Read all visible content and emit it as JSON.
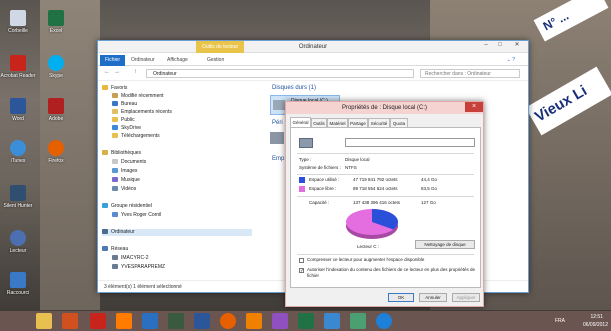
{
  "desktop": {
    "icons": [
      "Corbeille",
      "Acrobat Reader",
      "Word",
      "Excel",
      "iTunes",
      "Skype",
      "Adobe",
      "Lecteur",
      "Firefox",
      "Silent Hunter",
      "Raccourci"
    ]
  },
  "street_signs": {
    "sign1": "N° ...",
    "sign2": "Vieux Li"
  },
  "explorer": {
    "title": "Ordinateur",
    "context_tab": "Outils de lecteur",
    "ribbon_tabs": [
      "Fichier",
      "Ordinateur",
      "Affichage",
      "Gestion"
    ],
    "address": "Ordinateur",
    "search_placeholder": "Rechercher dans : Ordinateur",
    "nav": {
      "favoris": "Favoris",
      "modifie": "Modifié récemment",
      "bureau": "Bureau",
      "emplacements": "Emplacements récents",
      "public": "Public",
      "skydrive": "SkyDrive",
      "telechargements": "Téléchargements",
      "bibliotheques": "Bibliothèques",
      "documents": "Documents",
      "images": "Images",
      "musique": "Musique",
      "videos": "Vidéos",
      "groupe": "Groupe résidentiel",
      "user": "Yves Roger Cornil",
      "ordinateur": "Ordinateur",
      "reseau": "Réseau",
      "net1": "IMACYRC-2",
      "net2": "YVESPARAPREMZ"
    },
    "content": {
      "disques_header": "Disques durs (1)",
      "disque_local": "Disque local (C:)",
      "peripheriques": "Péri",
      "emplacements": "Emp"
    },
    "status": "3 élément(s)     1 élément sélectionné"
  },
  "props": {
    "title": "Propriétés de : Disque local (C:)",
    "tabs": [
      "Général",
      "Outils",
      "Matériel",
      "Partage",
      "Sécurité",
      "Quota"
    ],
    "type_label": "Type :",
    "type_value": "Disque local",
    "fs_label": "Système de fichiers :",
    "fs_value": "NTFS",
    "used_label": "Espace utilisé :",
    "used_bytes": "47 719 841 792 octets",
    "used_gb": "44,4 Go",
    "free_label": "Espace libre :",
    "free_bytes": "89 718 554 624 octets",
    "free_gb": "83,5 Go",
    "capacity_label": "Capacité :",
    "capacity_bytes": "137 438 396 416 octets",
    "capacity_gb": "127 Go",
    "drive_label": "Lecteur C :",
    "cleanup": "Nettoyage de disque",
    "compress": "Compresser ce lecteur pour augmenter l'espace disponible",
    "index": "Autoriser l'indexation du contenu des fichiers de ce lecteur en plus des propriétés de fichier",
    "ok": "OK",
    "cancel": "Annuler",
    "apply": "Appliquer",
    "used_color": "#2a4fd8",
    "free_color": "#e46ee0",
    "used_fraction": 0.347
  },
  "taskbar": {
    "apps": [
      "explorer",
      "media",
      "acrobat",
      "illustrator",
      "photoshop",
      "word",
      "firefox",
      "vlc",
      "paint",
      "excel",
      "mail",
      "network",
      "ie"
    ],
    "time": "12:51",
    "date": "06/09/2012",
    "lang": "FRA"
  }
}
